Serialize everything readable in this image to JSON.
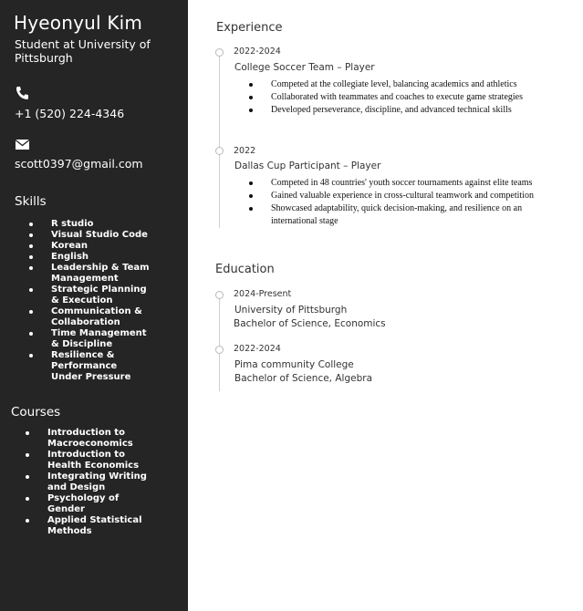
{
  "sidebar": {
    "name": "Hyeonyul Kim",
    "title": "Student at University of Pittsburgh",
    "phone_icon": "phone-icon",
    "phone": "+1 (520) 224-4346",
    "email_icon": "envelope-icon",
    "email": "scott0397@gmail.com",
    "skills_heading": "Skills",
    "skills": [
      "R studio",
      "Visual Studio Code",
      "Korean",
      "English",
      "Leadership & Team Management",
      "Strategic Planning & Execution",
      "Communication & Collaboration",
      "Time Management & Discipline",
      "Resilience & Performance Under Pressure"
    ],
    "courses_heading": "Courses",
    "courses": [
      "Introduction to Macroeconomics",
      "Introduction to Health Economics",
      "Integrating Writing and Design",
      "Psychology of Gender",
      "Applied Statistical Methods"
    ]
  },
  "experience": {
    "heading": "Experience",
    "entries": [
      {
        "date": "2022-2024",
        "title": "College Soccer Team – Player",
        "bullets": [
          "Competed at the collegiate level, balancing academics and athletics",
          "Collaborated with teammates and coaches to execute game strategies",
          "Developed perseverance, discipline, and advanced technical skills"
        ]
      },
      {
        "date": "2022",
        "title": "Dallas Cup Participant – Player",
        "bullets": [
          "Competed in 48 countries' youth soccer tournaments against elite teams",
          "Gained valuable experience in cross-cultural teamwork and competition",
          "Showcased adaptability, quick decision-making, and resilience on an international stage"
        ]
      }
    ]
  },
  "education": {
    "heading": "Education",
    "entries": [
      {
        "date": "2024-Present",
        "school": "University of Pittsburgh",
        "degree": "Bachelor of Science, Economics"
      },
      {
        "date": "2022-2024",
        "school": "Pima community College",
        "degree": "Bachelor of Science, Algebra"
      }
    ]
  }
}
